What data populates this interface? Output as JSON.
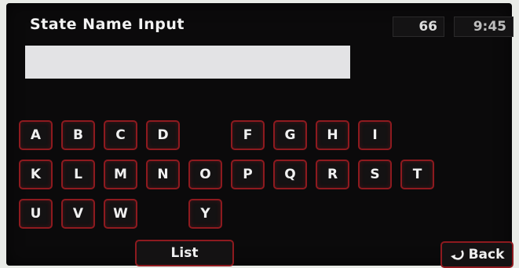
{
  "header": {
    "title": "State Name Input",
    "count": "66",
    "clock": "9:45"
  },
  "input": {
    "value": "",
    "placeholder": ""
  },
  "keyboard": {
    "row1": [
      "A",
      "B",
      "C",
      "D",
      "F",
      "G",
      "H",
      "I"
    ],
    "row2": [
      "K",
      "L",
      "M",
      "N",
      "O",
      "P",
      "Q",
      "R",
      "S",
      "T"
    ],
    "row3": [
      "U",
      "V",
      "W",
      "Y"
    ]
  },
  "footer": {
    "list_label": "List",
    "back_label": "Back",
    "back_icon": "return-arrow-icon"
  },
  "colors": {
    "key_border": "#8e1a1f",
    "screen_bg": "#0b0a0b",
    "input_bg": "#e3e3e5"
  }
}
